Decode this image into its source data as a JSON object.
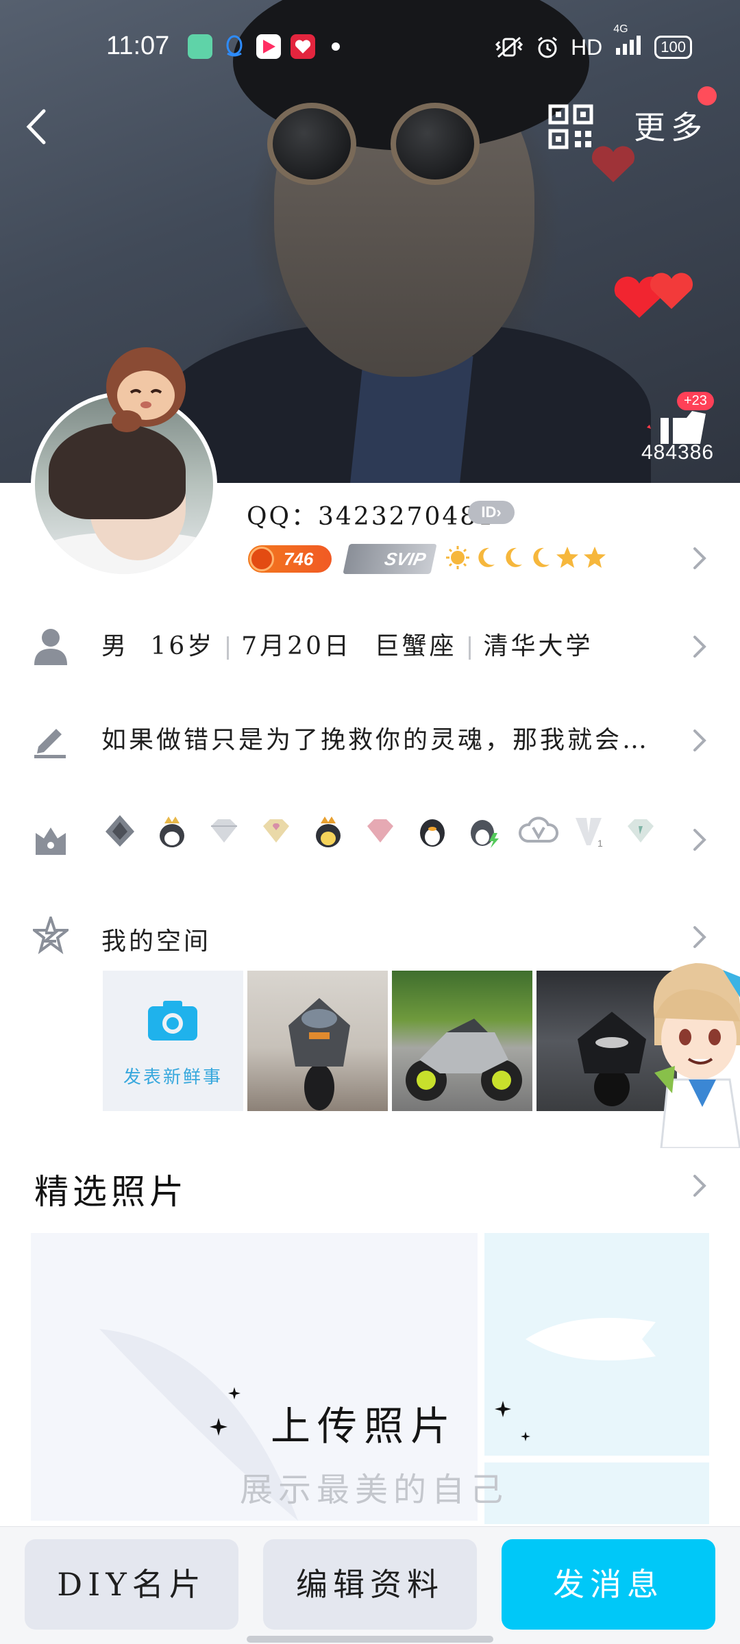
{
  "status_bar": {
    "time": "11:07",
    "network": "HD",
    "signal": "4G",
    "battery": "100"
  },
  "header": {
    "more_label": "更多",
    "likes_count": "484386",
    "likes_delta": "+23"
  },
  "profile": {
    "qq_label": "QQ：3423270481",
    "id_badge": "ID",
    "level_number": "746",
    "svip_label": "SVIP"
  },
  "info": {
    "gender": "男",
    "age": "16岁",
    "birthday": "7月20日",
    "zodiac": "巨蟹座",
    "school": "清华大学",
    "signature": "如果做错只是为了挽救你的灵魂，那我就会…"
  },
  "space": {
    "title": "我的空间",
    "post_new_label": "发表新鲜事"
  },
  "featured": {
    "title": "精选照片",
    "upload_title": "上传照片",
    "upload_subtitle": "展示最美的自己"
  },
  "bottom_bar": {
    "diy_label": "DIY名片",
    "edit_label": "编辑资料",
    "message_label": "发消息"
  },
  "colors": {
    "accent": "#00c8f8",
    "level_orange": "#f15a24",
    "badge_red": "#ff4057"
  }
}
